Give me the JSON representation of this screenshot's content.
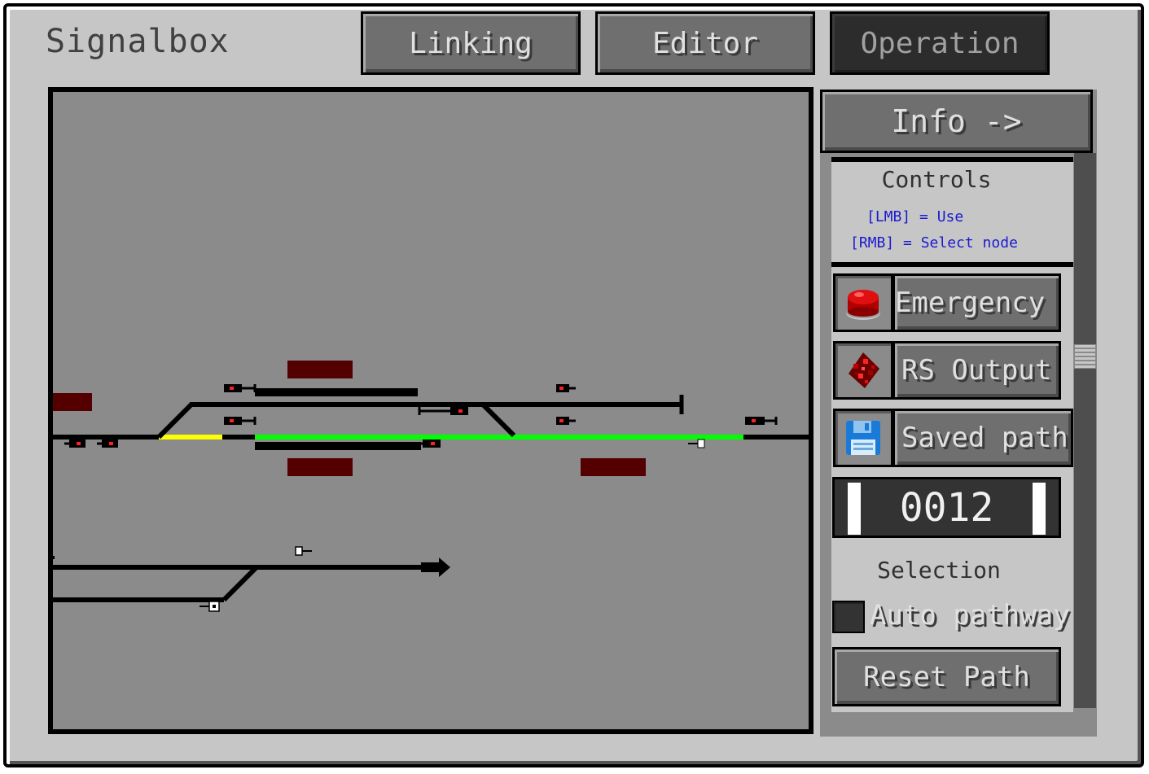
{
  "window": {
    "title": "Signalbox"
  },
  "tabs": [
    {
      "label": "Linking",
      "active": false
    },
    {
      "label": "Editor",
      "active": false
    },
    {
      "label": "Operation",
      "active": true
    }
  ],
  "sidebar": {
    "info_label": "Info ->",
    "controls": {
      "heading": "Controls",
      "hint_lmb": "[LMB] = Use",
      "hint_rmb": "[RMB] = Select node"
    },
    "buttons": {
      "emergency": {
        "label": "Emergency",
        "icon": "red-button-icon"
      },
      "rs_output": {
        "label": "RS Output",
        "icon": "redstone-dust-icon"
      },
      "saved_path": {
        "label": "Saved path",
        "icon": "floppy-disk-icon"
      }
    },
    "counter": "0012",
    "selection": {
      "heading": "Selection",
      "auto_pathway_label": "Auto pathway",
      "auto_pathway_checked": false
    },
    "reset_path_label": "Reset Path"
  },
  "colors": {
    "panel_bg": "#c6c6c6",
    "map_bg": "#8b8b8b",
    "track": "#000000",
    "route_set": "#00ff00",
    "route_pending": "#ffff00",
    "occupied_block": "#550000",
    "signal_red": "#ff0000",
    "hint_text": "#1a1ad0"
  }
}
